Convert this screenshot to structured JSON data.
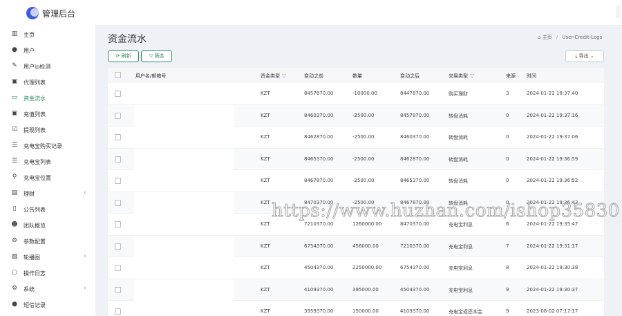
{
  "brand": "管理后台",
  "sidebar": {
    "items": [
      {
        "label": "主页",
        "icon": "dashboard-icon",
        "glyph": "▥"
      },
      {
        "label": "用户",
        "icon": "user-icon",
        "glyph": "●"
      },
      {
        "label": "用户ip检测",
        "icon": "magic-icon",
        "glyph": "✎"
      },
      {
        "label": "代理列表",
        "icon": "id-card-icon",
        "glyph": "▣"
      },
      {
        "label": "资金流水",
        "icon": "money-icon",
        "glyph": "▭",
        "active": true
      },
      {
        "label": "充值列表",
        "icon": "recharge-icon",
        "glyph": "▣"
      },
      {
        "label": "提现列表",
        "icon": "withdraw-icon",
        "glyph": "☑"
      },
      {
        "label": "充电宝购买记录",
        "icon": "list-icon",
        "glyph": "☰"
      },
      {
        "label": "充电宝列表",
        "icon": "card-list-icon",
        "glyph": "☰"
      },
      {
        "label": "充电宝位置",
        "icon": "map-marker-icon",
        "glyph": "⚲"
      },
      {
        "label": "理财",
        "icon": "wallet-icon",
        "glyph": "▤",
        "chevron": true
      },
      {
        "label": "公告列表",
        "icon": "document-icon",
        "glyph": "▯"
      },
      {
        "label": "团队概览",
        "icon": "team-icon",
        "glyph": "☻"
      },
      {
        "label": "参数配置",
        "icon": "cogs-icon",
        "glyph": "⚙"
      },
      {
        "label": "轮播图",
        "icon": "image-icon",
        "glyph": "▨",
        "chevron": true
      },
      {
        "label": "操作日志",
        "icon": "log-icon",
        "glyph": "○"
      },
      {
        "label": "系统",
        "icon": "settings-icon",
        "glyph": "⚙",
        "chevron": true
      },
      {
        "label": "短信记录",
        "icon": "sms-icon",
        "glyph": "●"
      }
    ]
  },
  "page": {
    "title": "资金流水",
    "breadcrumb_home": "主页",
    "breadcrumb_sep": "/",
    "breadcrumb_current": "User-Credit-Logs"
  },
  "toolbar": {
    "refresh_label": "刷新",
    "filter_label": "筛选",
    "export_label": "导出"
  },
  "table": {
    "columns": [
      "用户名/邮箱号",
      "资金类型",
      "变动之前",
      "数量",
      "变动之后",
      "交易类型",
      "来源",
      "时间"
    ],
    "rows": [
      [
        "KZT",
        "8457870.00",
        "-10000.00",
        "8447870.00",
        "购买理财",
        "3",
        "2024-01-22 19:37:40"
      ],
      [
        "KZT",
        "8460370.00",
        "-2500.00",
        "8457870.00",
        "转盘消耗",
        "0",
        "2024-01-22 19:37:16"
      ],
      [
        "KZT",
        "8462870.00",
        "-2500.00",
        "8460370.00",
        "转盘消耗",
        "0",
        "2024-01-22 19:37:06"
      ],
      [
        "KZT",
        "8465370.00",
        "-2500.00",
        "8462870.00",
        "转盘消耗",
        "0",
        "2024-01-22 19:36:59"
      ],
      [
        "KZT",
        "8467870.00",
        "-2500.00",
        "8465370.00",
        "转盘消耗",
        "0",
        "2024-01-22 19:36:52"
      ],
      [
        "KZT",
        "8470370.00",
        "-2500.00",
        "8467870.00",
        "转盘消耗",
        "0",
        "2024-01-22 19:36:43"
      ],
      [
        "KZT",
        "7210370.00",
        "1260000.00",
        "8470370.00",
        "充电宝利息",
        "6",
        "2024-01-22 19:35:47"
      ],
      [
        "KZT",
        "6754370.00",
        "456000.00",
        "7210370.00",
        "充电宝利息",
        "7",
        "2024-01-22 19:31:17"
      ],
      [
        "KZT",
        "4504370.00",
        "2250000.00",
        "6754370.00",
        "充电宝利息",
        "8",
        "2024-01-22 19:30:38"
      ],
      [
        "KZT",
        "4109370.00",
        "395000.00",
        "4504370.00",
        "充电宝利息",
        "9",
        "2024-01-22 19:30:37"
      ],
      [
        "KZT",
        "3959370.00",
        "150000.00",
        "4109370.00",
        "充电宝返还本金",
        "9",
        "2023-08-02 07:17:17"
      ]
    ]
  },
  "watermark": "https://www.huzhan.com/ishop35830",
  "colors": {
    "accent": "#2e8a63",
    "brand_logo": "#3b5bdb",
    "background": "#eef1f5"
  }
}
